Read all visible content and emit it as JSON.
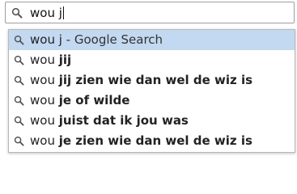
{
  "search": {
    "query": "wou j",
    "icon": "search-icon"
  },
  "suggestions": [
    {
      "typed": "wou j",
      "completion": "",
      "suffix": " - Google Search",
      "selected": true,
      "icon": "search-icon"
    },
    {
      "typed": "wou ",
      "completion": "jij",
      "suffix": "",
      "selected": false,
      "icon": "search-icon"
    },
    {
      "typed": "wou ",
      "completion": "jij zien wie dan wel de wiz is",
      "suffix": "",
      "selected": false,
      "icon": "search-icon"
    },
    {
      "typed": "wou ",
      "completion": "je of wilde",
      "suffix": "",
      "selected": false,
      "icon": "search-icon"
    },
    {
      "typed": "wou ",
      "completion": "juist dat ik jou was",
      "suffix": "",
      "selected": false,
      "icon": "search-icon"
    },
    {
      "typed": "wou ",
      "completion": "je zien wie dan wel de wiz is",
      "suffix": "",
      "selected": false,
      "icon": "search-icon"
    }
  ],
  "colors": {
    "selected_row": "#c3d9f1",
    "text": "#222222",
    "border": "#9e9e9e"
  }
}
